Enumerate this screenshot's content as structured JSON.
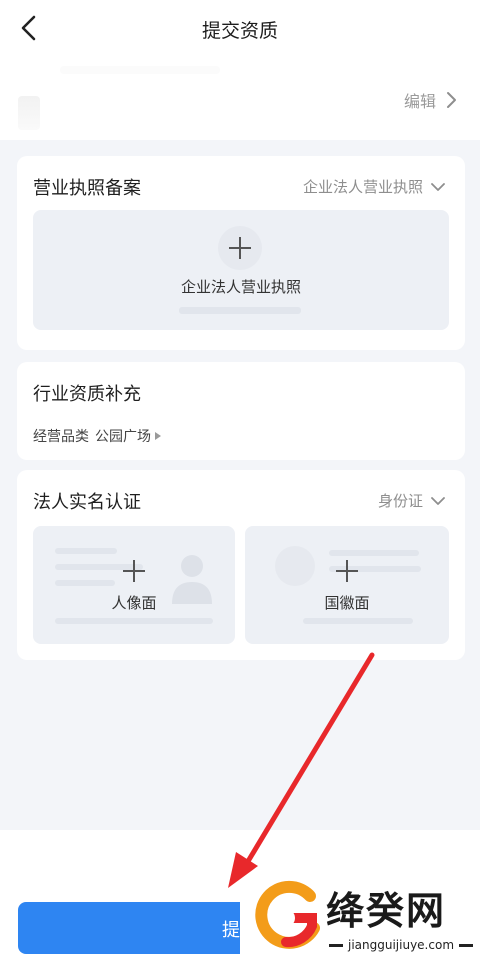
{
  "nav": {
    "title": "提交资质"
  },
  "profile": {
    "edit_label": "编辑"
  },
  "license_card": {
    "title": "营业执照备案",
    "selected_type": "企业法人营业执照",
    "upload_label": "企业法人营业执照"
  },
  "industry_card": {
    "title": "行业资质补充",
    "category_label": "经营品类",
    "category_value": "公园广场"
  },
  "identity_card": {
    "title": "法人实名认证",
    "selected_type": "身份证",
    "front_label": "人像面",
    "back_label": "国徽面"
  },
  "submit": {
    "label": "提交"
  },
  "watermark": {
    "brand": "绛癸网",
    "domain": "jiangguijiuye.com"
  },
  "colors": {
    "primary": "#2e85f2",
    "page_bg": "#f3f5f9",
    "arrow": "#e8282b"
  },
  "icons": [
    "back-arrow-icon",
    "chevron-right-icon",
    "chevron-down-icon",
    "plus-icon",
    "portrait-silhouette-icon",
    "emblem-circle-icon"
  ]
}
